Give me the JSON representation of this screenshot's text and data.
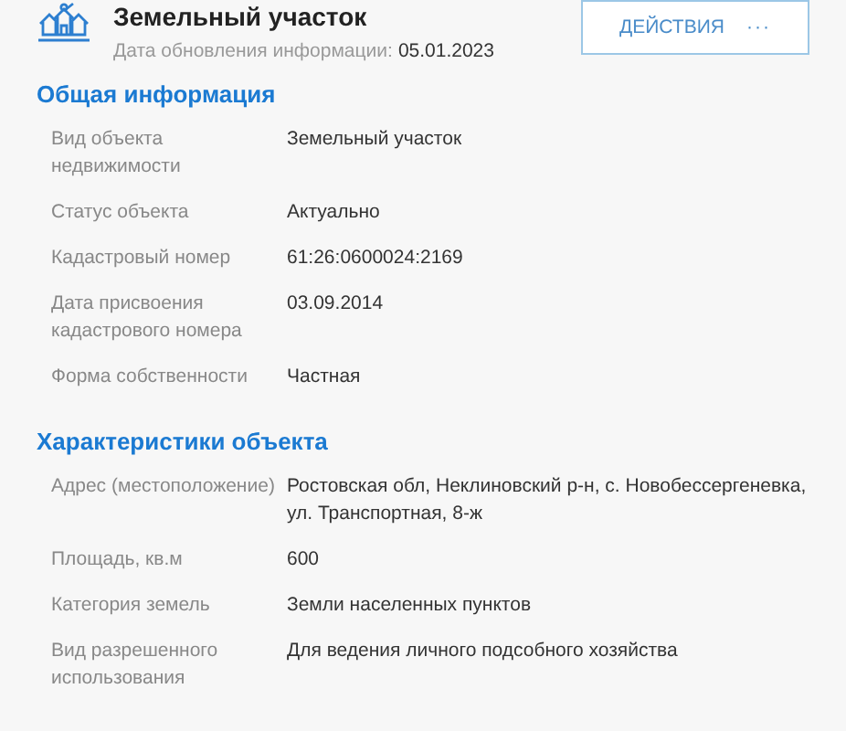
{
  "header": {
    "title": "Земельный участок",
    "date_label": "Дата обновления информации:",
    "date_value": "05.01.2023",
    "actions_button": {
      "label": "ДЕЙСТВИЯ",
      "icon": "···"
    }
  },
  "sections": [
    {
      "title": "Общая информация",
      "rows": [
        {
          "label": "Вид объекта недвижимости",
          "value": "Земельный участок"
        },
        {
          "label": "Статус объекта",
          "value": "Актуально"
        },
        {
          "label": "Кадастровый номер",
          "value": "61:26:0600024:2169"
        },
        {
          "label": "Дата присвоения кадастрового номера",
          "value": "03.09.2014"
        },
        {
          "label": "Форма собственности",
          "value": "Частная"
        }
      ]
    },
    {
      "title": "Характеристики объекта",
      "rows": [
        {
          "label": "Адрес (местоположение)",
          "value": "Ростовская обл, Неклиновский р-н, с. Новобессергеневка, ул. Транспортная, 8-ж"
        },
        {
          "label": "Площадь, кв.м",
          "value": "600"
        },
        {
          "label": "Категория земель",
          "value": "Земли населенных пунктов"
        },
        {
          "label": "Вид разрешенного использования",
          "value": "Для ведения личного подсобного хозяйства"
        }
      ]
    }
  ]
}
